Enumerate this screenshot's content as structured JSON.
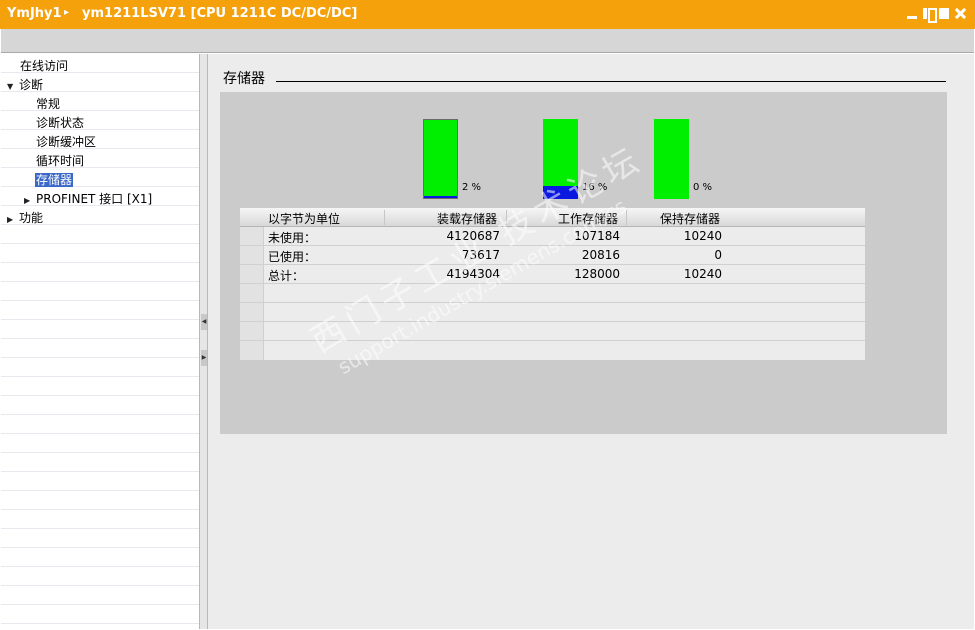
{
  "titlebar": {
    "device": "YmJhy1",
    "separator": "▸",
    "path": "ym1211LSV71 [CPU 1211C DC/DC/DC]"
  },
  "tree": {
    "items": [
      {
        "label": "在线访问",
        "indent": 0,
        "arrow": ""
      },
      {
        "label": "诊断",
        "indent": 0,
        "arrow": "▼"
      },
      {
        "label": "常规",
        "indent": 2,
        "arrow": ""
      },
      {
        "label": "诊断状态",
        "indent": 2,
        "arrow": ""
      },
      {
        "label": "诊断缓冲区",
        "indent": 2,
        "arrow": ""
      },
      {
        "label": "循环时间",
        "indent": 2,
        "arrow": ""
      },
      {
        "label": "存储器",
        "indent": 2,
        "arrow": "",
        "selected": true
      },
      {
        "label": "PROFINET 接口 [X1]",
        "indent": 1,
        "arrow": "▶"
      },
      {
        "label": "功能",
        "indent": 0,
        "arrow": "▶"
      }
    ]
  },
  "main": {
    "section_title": "存储器",
    "bars": [
      {
        "pct_label": "2 %",
        "fraction": 0.02
      },
      {
        "pct_label": "16 %",
        "fraction": 0.16
      },
      {
        "pct_label": "0 %",
        "fraction": 0.0
      }
    ],
    "table": {
      "headers": [
        "以字节为单位",
        "装载存储器",
        "工作存储器",
        "保持存储器"
      ],
      "rows": [
        [
          "未使用：",
          "4120687",
          "107184",
          "10240"
        ],
        [
          "已使用：",
          "73617",
          "20816",
          "0"
        ],
        [
          "总计：",
          "4194304",
          "128000",
          "10240"
        ]
      ]
    }
  },
  "watermark": {
    "cn": "西门子工业 技术论坛",
    "en": "support.industry.siemens.com/cs"
  },
  "colors": {
    "titlebar": "#f5a10c",
    "bar_free": "#00ee00",
    "bar_used": "#0a18e0",
    "selection": "#3a68c8"
  }
}
